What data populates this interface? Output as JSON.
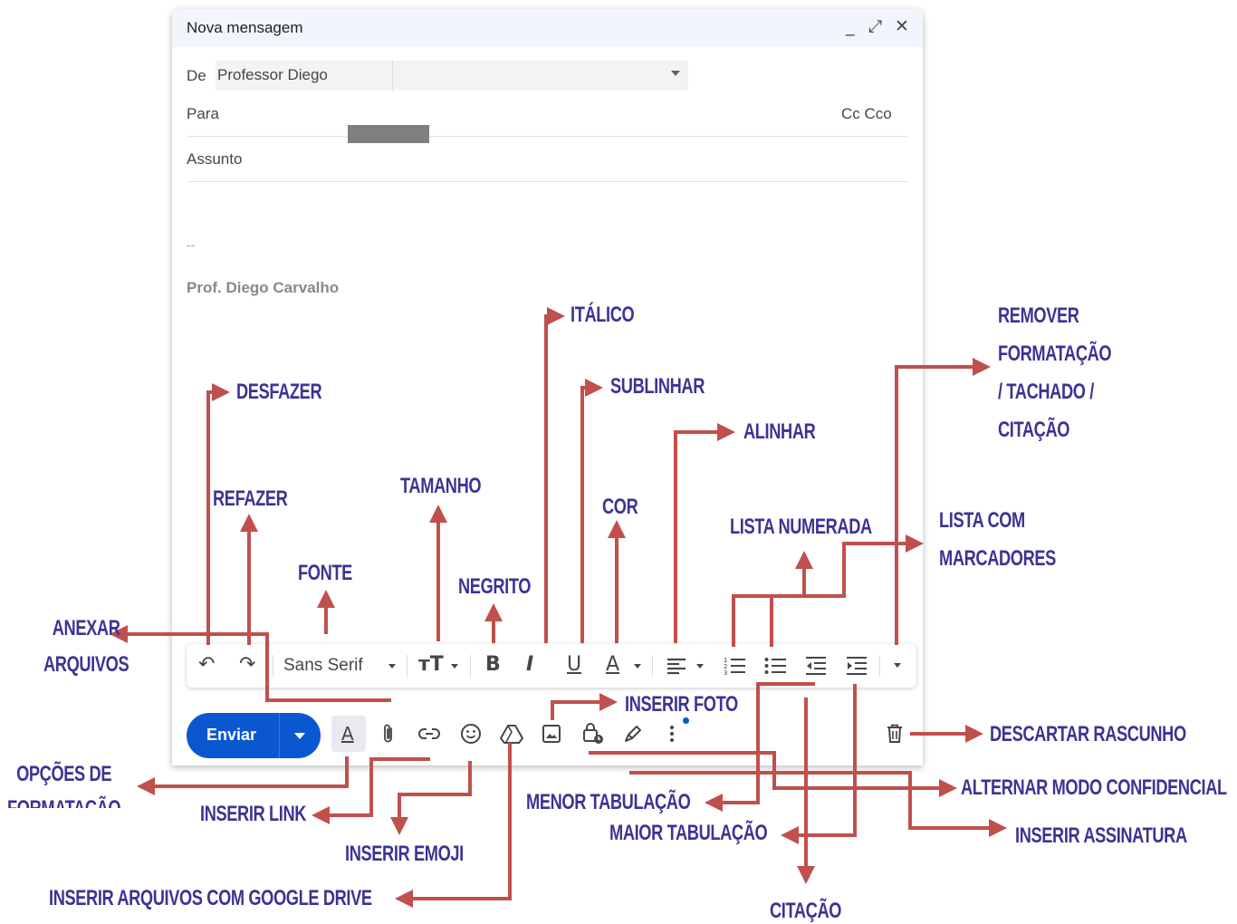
{
  "compose": {
    "title": "Nova mensagem",
    "window_controls": {
      "minimize": "_",
      "expand": "⤢",
      "close": "✕"
    },
    "from_label": "De",
    "from_value": "Professor Diego",
    "to_label": "Para",
    "cc_bcc": "Cc Cco",
    "subject_placeholder": "Assunto",
    "signature_dash": "--",
    "signature_name": "Prof. Diego Carvalho"
  },
  "formatting_toolbar": {
    "undo": "↶",
    "redo": "↷",
    "font": "Sans Serif",
    "size": "тT",
    "bold": "B",
    "italic": "I",
    "underline": "U",
    "color": "A"
  },
  "action_bar": {
    "send_label": "Enviar",
    "icons": [
      "formatting-options-icon",
      "attach-icon",
      "link-icon",
      "emoji-icon",
      "google-drive-icon",
      "insert-photo-icon",
      "confidential-mode-icon",
      "signature-icon",
      "more-options-icon",
      "trash-icon"
    ]
  },
  "annotations": {
    "desfazer": "DESFAZER",
    "refazer": "REFAZER",
    "fonte": "FONTE",
    "tamanho": "TAMANHO",
    "negrito": "NEGRITO",
    "italico": "ITÁLICO",
    "sublinhar": "SUBLINHAR",
    "cor": "COR",
    "alinhar": "ALINHAR",
    "lista_numerada": "LISTA NUMERADA",
    "lista_marcadores": "LISTA COM\nMARCADORES",
    "remover_formatacao": "REMOVER\nFORMATAÇÃO\n/ TACHADO /\nCITAÇÃO",
    "anexar": "ANEXAR\nARQUIVOS",
    "inserir_foto": "INSERIR FOTO",
    "descartar": "DESCARTAR RASCUNHO",
    "opcoes_formatacao": "OPÇÕES DE\nFORMATAÇÃO",
    "inserir_link": "INSERIR LINK",
    "inserir_emoji": "INSERIR EMOJI",
    "google_drive": "INSERIR ARQUIVOS COM GOOGLE DRIVE",
    "menor_tabulacao": "MENOR TABULAÇÃO",
    "maior_tabulacao": "MAIOR TABULAÇÃO",
    "citacao": "CITAÇÃO",
    "modo_confidencial": "ALTERNAR MODO CONFIDENCIAL",
    "inserir_assinatura": "INSERIR ASSINATURA"
  },
  "colors": {
    "annotation_text": "#3b3494",
    "arrow": "#c0504d",
    "send_button": "#0b57d0",
    "title_bar": "#f2f6fc"
  }
}
